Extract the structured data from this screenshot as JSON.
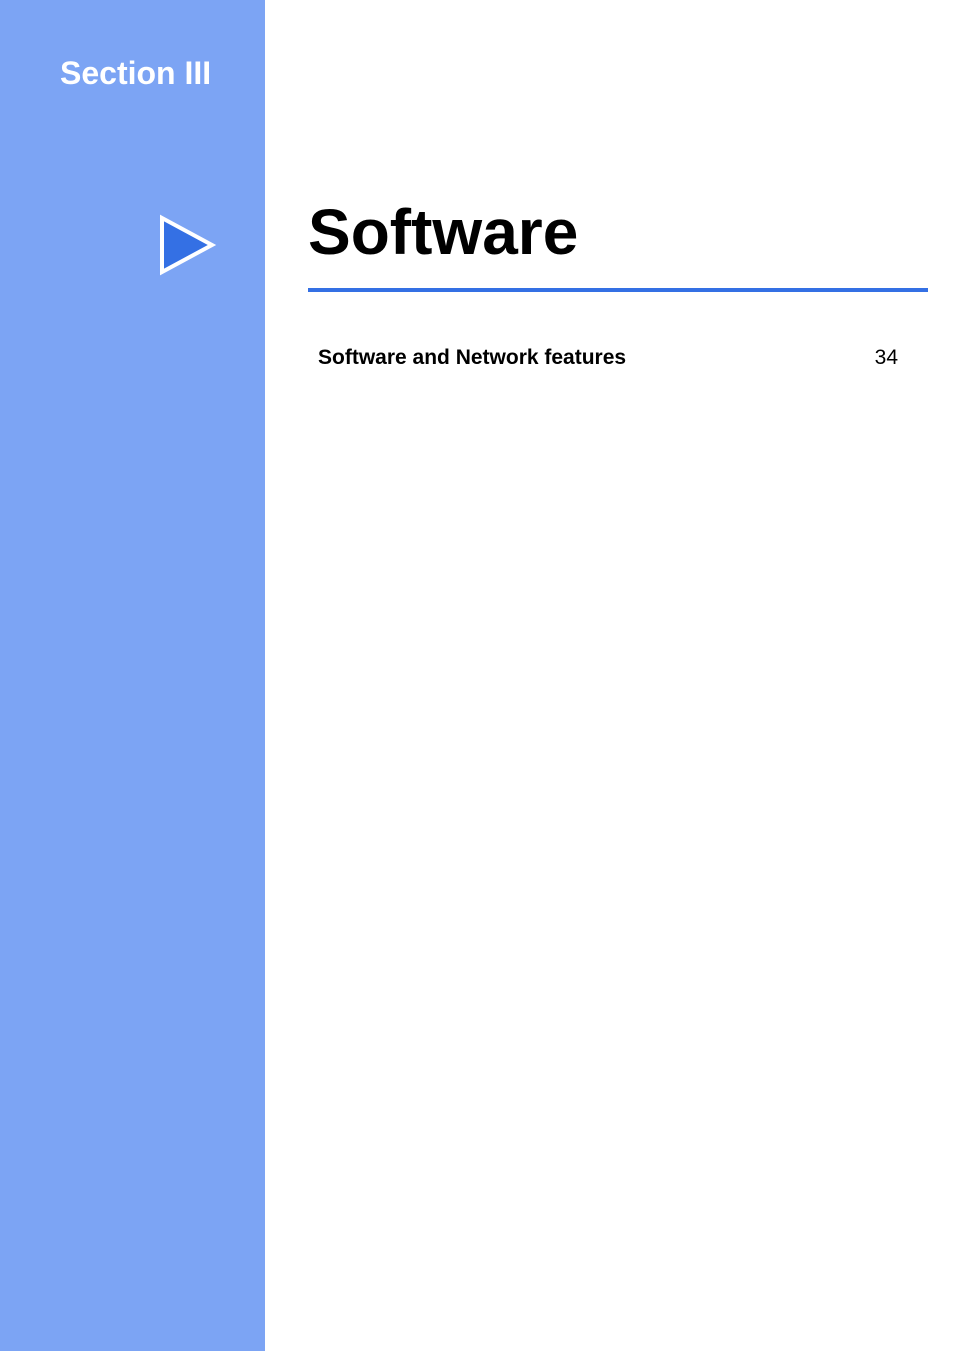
{
  "section_label": "Section III",
  "main_title": "Software",
  "toc": {
    "items": [
      {
        "label": "Software and Network features",
        "page": "34"
      }
    ]
  },
  "colors": {
    "sidebar": "#7ca4f4",
    "accent": "#3470e4",
    "text_light": "#ffffff",
    "text_dark": "#000000"
  }
}
